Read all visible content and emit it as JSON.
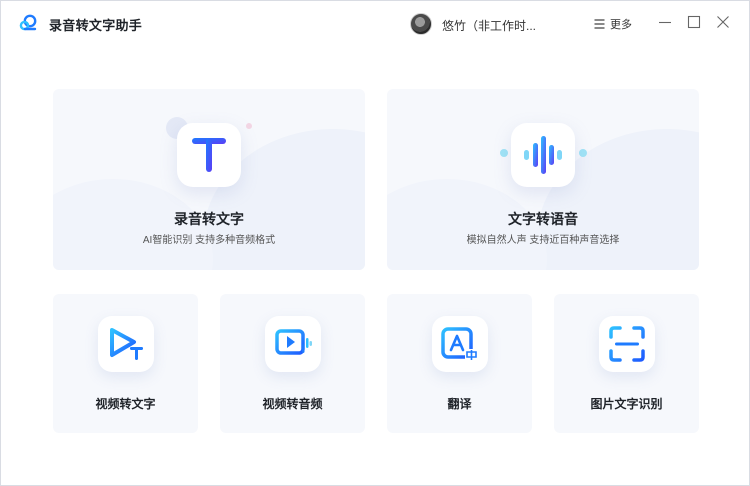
{
  "app": {
    "title": "录音转文字助手",
    "user_name": "悠竹（非工作时...",
    "more_label": "更多"
  },
  "icons": {
    "logo": "cloud-logo-icon",
    "more": "menu-lines-icon",
    "minimize": "minimize-icon",
    "maximize": "maximize-icon",
    "close": "close-icon"
  },
  "cards": {
    "speech_to_text": {
      "title": "录音转文字",
      "subtitle": "AI智能识别 支持多种音频格式",
      "icon": "letter-t-icon"
    },
    "text_to_speech": {
      "title": "文字转语音",
      "subtitle": "模拟自然人声 支持近百种声音选择",
      "icon": "sound-wave-icon"
    },
    "video_to_text": {
      "title": "视频转文字",
      "icon": "video-text-icon"
    },
    "video_to_audio": {
      "title": "视频转音频",
      "icon": "video-audio-icon"
    },
    "translate": {
      "title": "翻译",
      "icon": "translate-icon"
    },
    "image_ocr": {
      "title": "图片文字识别",
      "icon": "scan-icon"
    }
  },
  "colors": {
    "accent_blue": "#1e7bff",
    "accent_indigo": "#5b3df5",
    "card_bg": "#f6f8fc"
  }
}
